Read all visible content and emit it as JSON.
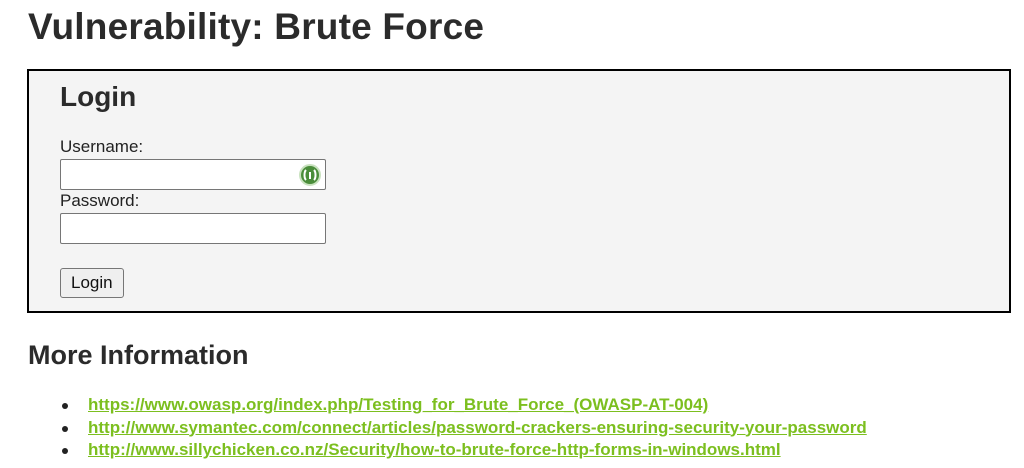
{
  "page": {
    "title": "Vulnerability: Brute Force"
  },
  "login": {
    "heading": "Login",
    "username_label": "Username:",
    "username_value": "",
    "password_label": "Password:",
    "password_value": "",
    "button_label": "Login",
    "password_manager_icon": "password-manager-icon"
  },
  "more_info": {
    "heading": "More Information",
    "links": [
      {
        "text": "https://www.owasp.org/index.php/Testing_for_Brute_Force_(OWASP-AT-004)"
      },
      {
        "text": "http://www.symantec.com/connect/articles/password-crackers-ensuring-security-your-password"
      },
      {
        "text": "http://www.sillychicken.co.nz/Security/how-to-brute-force-http-forms-in-windows.html"
      }
    ]
  },
  "colors": {
    "link": "#7cbf1f",
    "box_background": "#f4f4f4",
    "box_border": "#000000"
  }
}
